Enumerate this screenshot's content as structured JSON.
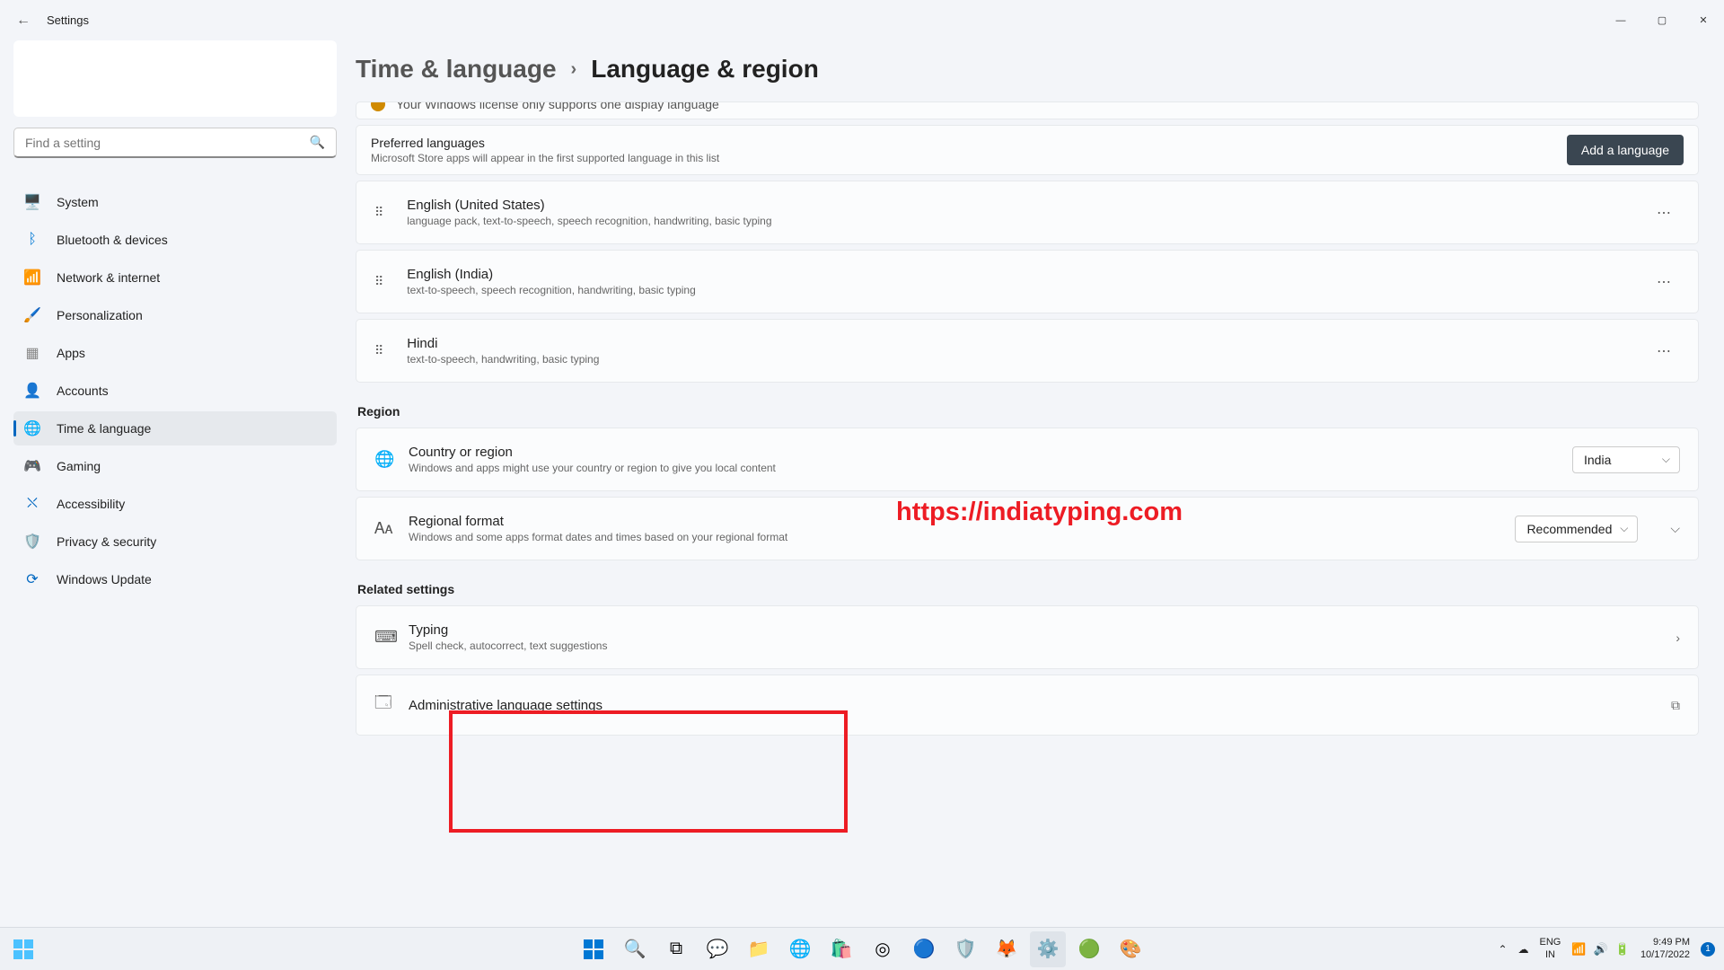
{
  "app_title": "Settings",
  "window_controls": {
    "min": "—",
    "max": "▢",
    "close": "✕"
  },
  "search": {
    "placeholder": "Find a setting"
  },
  "nav": [
    {
      "label": "System",
      "icon": "🖥️"
    },
    {
      "label": "Bluetooth & devices",
      "icon": "ᛒ",
      "icon_color": "#0078d4"
    },
    {
      "label": "Network & internet",
      "icon": "📶",
      "icon_color": "#0aa5c6"
    },
    {
      "label": "Personalization",
      "icon": "🖌️"
    },
    {
      "label": "Apps",
      "icon": "▦",
      "icon_color": "#888"
    },
    {
      "label": "Accounts",
      "icon": "👤",
      "icon_color": "#2a9d5f"
    },
    {
      "label": "Time & language",
      "icon": "🌐",
      "icon_color": "#4aa8e0",
      "active": true
    },
    {
      "label": "Gaming",
      "icon": "🎮",
      "icon_color": "#888"
    },
    {
      "label": "Accessibility",
      "icon": "⛌",
      "icon_color": "#0067c0"
    },
    {
      "label": "Privacy & security",
      "icon": "🛡️",
      "icon_color": "#888"
    },
    {
      "label": "Windows Update",
      "icon": "⟳",
      "icon_color": "#0067c0"
    }
  ],
  "breadcrumb": {
    "parent": "Time & language",
    "current": "Language & region"
  },
  "warning_text": "Your Windows license only supports one display language",
  "preferred": {
    "title": "Preferred languages",
    "desc": "Microsoft Store apps will appear in the first supported language in this list",
    "add_btn": "Add a language"
  },
  "languages": [
    {
      "name": "English (United States)",
      "features": "language pack, text-to-speech, speech recognition, handwriting, basic typing"
    },
    {
      "name": "English (India)",
      "features": "text-to-speech, speech recognition, handwriting, basic typing"
    },
    {
      "name": "Hindi",
      "features": "text-to-speech, handwriting, basic typing"
    }
  ],
  "region": {
    "label": "Region",
    "country": {
      "title": "Country or region",
      "desc": "Windows and apps might use your country or region to give you local content",
      "value": "India"
    },
    "format": {
      "title": "Regional format",
      "desc": "Windows and some apps format dates and times based on your regional format",
      "value": "Recommended"
    }
  },
  "related": {
    "label": "Related settings",
    "typing": {
      "title": "Typing",
      "desc": "Spell check, autocorrect, text suggestions"
    },
    "admin": {
      "title": "Administrative language settings"
    }
  },
  "watermark": "https://indiatyping.com",
  "taskbar": {
    "lang": {
      "top": "ENG",
      "bottom": "IN"
    },
    "clock": {
      "time": "9:49 PM",
      "date": "10/17/2022"
    },
    "notif_count": "1"
  }
}
